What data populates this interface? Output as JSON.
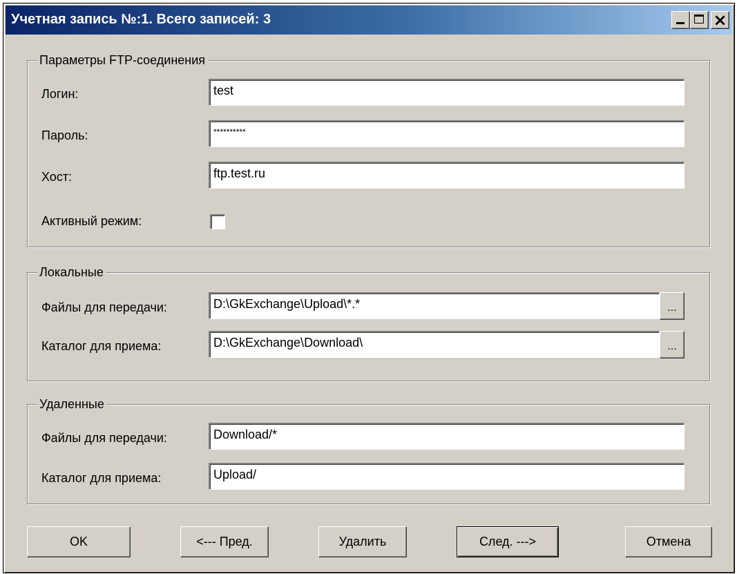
{
  "window": {
    "title": "Учетная запись №:1. Всего записей: 3"
  },
  "ftp": {
    "legend": "Параметры FTP-соединения",
    "login_label": "Логин:",
    "login_value": "test",
    "password_label": "Пароль:",
    "password_value": "**********",
    "host_label": "Хост:",
    "host_value": "ftp.test.ru",
    "active_label": "Активный режим:",
    "active_checked": false
  },
  "local": {
    "legend": "Локальные",
    "send_label": "Файлы для передачи:",
    "send_value": "D:\\GkExchange\\Upload\\*.*",
    "recv_label": "Каталог для приема:",
    "recv_value": "D:\\GkExchange\\Download\\",
    "browse_label": "..."
  },
  "remote": {
    "legend": "Удаленные",
    "send_label": "Файлы для передачи:",
    "send_value": "Download/*",
    "recv_label": "Каталог для приема:",
    "recv_value": "Upload/"
  },
  "buttons": {
    "ok": "OK",
    "prev": "<--- Пред.",
    "delete": "Удалить",
    "next": "След. --->",
    "cancel": "Отмена"
  }
}
